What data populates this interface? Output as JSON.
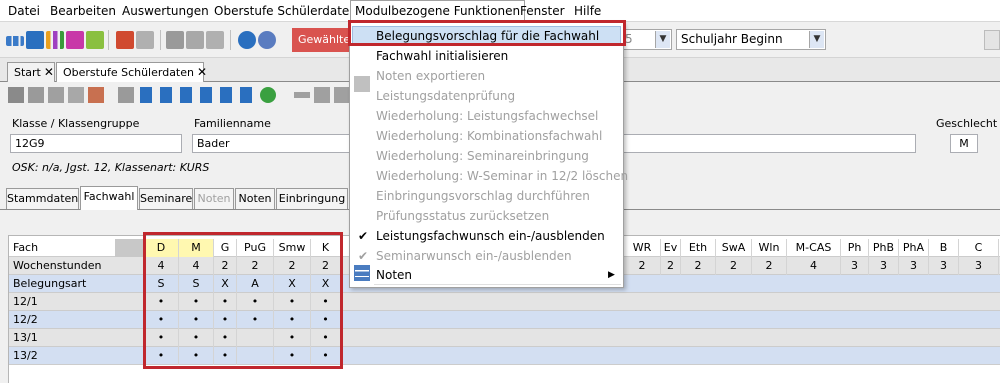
{
  "menubar": {
    "items": [
      "Datei",
      "Bearbeiten",
      "Auswertungen",
      "Oberstufe Schülerdaten",
      "Modulbezogene Funktionen",
      "Fenster",
      "Hilfe"
    ]
  },
  "toolbar": {
    "selection_button": "Gewähltes",
    "combo_partial": "5",
    "term_combo": "Schuljahr Beginn"
  },
  "doc_tabs": [
    {
      "label": "Start"
    },
    {
      "label": "Oberstufe Schülerdaten"
    }
  ],
  "form": {
    "class_label": "Klasse / Klassengruppe",
    "class_value": "12G9",
    "surname_label": "Familienname",
    "surname_value": "Bader",
    "gender_label": "Geschlecht",
    "gender_value": "M",
    "osk_info": "OSK: n/a, Jgst. 12, Klassenart: KURS"
  },
  "page_tabs": [
    "Stammdaten",
    "Fachwahl",
    "Seminare",
    "Noten",
    "Noten",
    "Einbringung"
  ],
  "dropdown": {
    "items": [
      {
        "label": "Belegungsvorschlag für die Fachwahl",
        "enabled": true,
        "highlighted": true
      },
      {
        "label": "Fachwahl initialisieren",
        "enabled": true
      },
      {
        "label": "Noten exportieren",
        "enabled": false
      },
      {
        "label": "Leistungsdatenprüfung",
        "enabled": false
      },
      {
        "label": "Wiederholung: Leistungsfachwechsel",
        "enabled": false
      },
      {
        "label": "Wiederholung: Kombinationsfachwahl",
        "enabled": false
      },
      {
        "label": "Wiederholung: Seminareinbringung",
        "enabled": false
      },
      {
        "label": "Wiederholung: W-Seminar in 12/2 löschen",
        "enabled": false
      },
      {
        "label": "Einbringungsvorschlag durchführen",
        "enabled": false
      },
      {
        "label": "Prüfungsstatus zurücksetzen",
        "enabled": false
      },
      {
        "label": "Leistungsfachwunsch ein-/ausblenden",
        "enabled": true,
        "checked": true
      },
      {
        "label": "Seminarwunsch ein-/ausblenden",
        "enabled": false,
        "checked": true
      }
    ],
    "submenu": {
      "label": "Noten",
      "arrow": "▶"
    }
  },
  "grid": {
    "header_label": "Fach",
    "row_labels": [
      "Wochenstunden",
      "Belegungsart",
      "12/1",
      "12/2",
      "13/1",
      "13/2"
    ],
    "left_subjects": [
      "D",
      "M",
      "G",
      "PuG",
      "Smw",
      "K"
    ],
    "left_values": [
      [
        "4",
        "4",
        "2",
        "2",
        "2",
        "2"
      ],
      [
        "S",
        "S",
        "X",
        "A",
        "X",
        "X"
      ],
      [
        "•",
        "•",
        "•",
        "•",
        "•",
        "•"
      ],
      [
        "•",
        "•",
        "•",
        "•",
        "•",
        "•"
      ],
      [
        "•",
        "•",
        "•",
        "",
        "•",
        "•"
      ],
      [
        "•",
        "•",
        "•",
        "",
        "•",
        "•"
      ]
    ],
    "right_subjects": [
      "WR",
      "Ev",
      "Eth",
      "SwA",
      "Wln",
      "M-CAS",
      "Ph",
      "PhB",
      "PhA",
      "B",
      "C"
    ],
    "right_hours": [
      "2",
      "2",
      "2",
      "2",
      "2",
      "4",
      "3",
      "3",
      "3",
      "3",
      "3"
    ]
  },
  "colors": {
    "menu_highlight": "#cde0f4",
    "red_frame": "#c0272d",
    "yellow_header": "#fff8b0",
    "blue_row": "#d3dff2",
    "gray_row": "#e4e4e4"
  }
}
